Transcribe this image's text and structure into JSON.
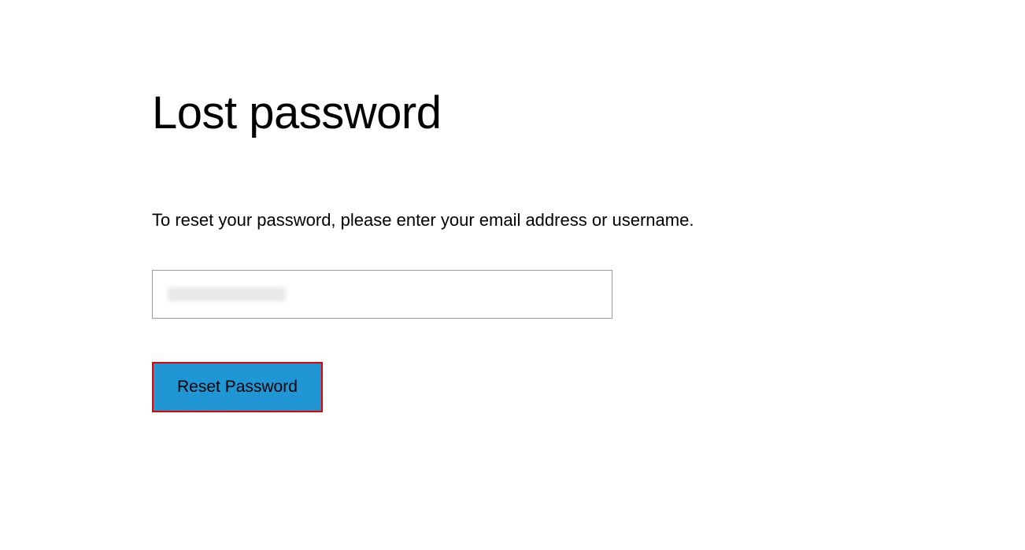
{
  "page": {
    "title": "Lost password",
    "instruction": "To reset your password, please enter your email address or username."
  },
  "form": {
    "email_value": "",
    "email_placeholder": "",
    "reset_button_label": "Reset Password"
  }
}
